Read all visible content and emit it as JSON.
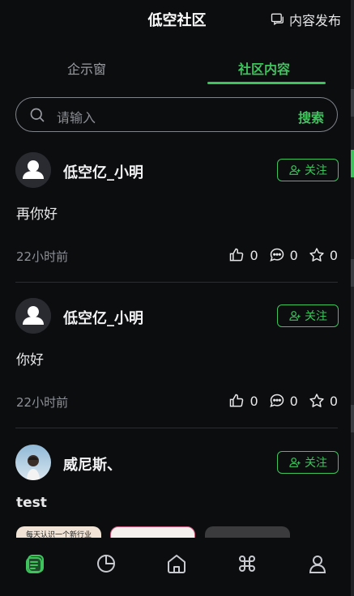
{
  "header": {
    "title": "低空社区",
    "publish_label": "内容发布"
  },
  "tabs": [
    {
      "label": "企示窗"
    },
    {
      "label": "社区内容"
    }
  ],
  "search": {
    "placeholder": "请输入",
    "button_label": "搜索"
  },
  "posts": [
    {
      "user": "低空亿_小明",
      "follow_label": "关注",
      "content": "再你好",
      "time": "22小时前",
      "likes": "0",
      "comments": "0",
      "favorites": "0"
    },
    {
      "user": "低空亿_小明",
      "follow_label": "关注",
      "content": "你好",
      "time": "22小时前",
      "likes": "0",
      "comments": "0",
      "favorites": "0"
    },
    {
      "user": "威尼斯、",
      "follow_label": "关注",
      "content": "test",
      "thumbnails": [
        {
          "text": "每天认识一个新行业"
        },
        {
          "text": ""
        },
        {
          "text": ""
        }
      ]
    }
  ],
  "bottom_nav": [
    {
      "icon": "list-icon",
      "active": true
    },
    {
      "icon": "pie-chart-icon"
    },
    {
      "icon": "home-icon"
    },
    {
      "icon": "grid-icon"
    },
    {
      "icon": "user-icon"
    }
  ],
  "colors": {
    "accent": "#3ec35d",
    "background": "#0c0d0f",
    "muted": "#8d9097"
  }
}
